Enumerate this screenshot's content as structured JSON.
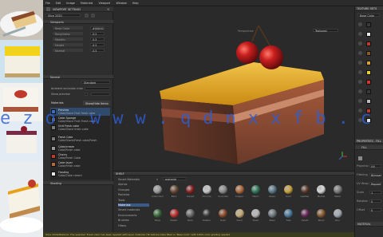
{
  "menu": [
    "File",
    "Edit",
    "Image",
    "Materials",
    "Viewport",
    "Window",
    "Help"
  ],
  "left_panel": {
    "title": "VIEWPORT SETTINGS",
    "preset": "Slice 2020",
    "section1": "Viewports",
    "fields": [
      {
        "label": "Base Color",
        "value": "#00000"
      },
      {
        "label": "Roughness",
        "value": "0.5"
      },
      {
        "label": "Metallic",
        "value": "0.5"
      },
      {
        "label": "Height",
        "value": "0.5"
      },
      {
        "label": "Normal",
        "value": "0.5"
      }
    ],
    "section2": "Normal",
    "normal_mode": "Standard",
    "ambient_label": "Ambient occlusion mixing",
    "show_label": "Show preview",
    "materials_label": "Materials",
    "materials_btn": "Show/Hide Items",
    "section3": "Shading",
    "layers": [
      {
        "name": "Preview",
        "desc": "Cake/Glace Fruit fresh cake",
        "color": "#3a6fc7"
      },
      {
        "name": "Cake Sponge",
        "desc": "Cake/Glace Fruit Fresh cake",
        "color": "#6a6a6a"
      },
      {
        "name": "Unit Fresh cake",
        "desc": "Cake/Glace fresh cake",
        "color": "#7a7a7a"
      },
      {
        "name": "Fresh Cake",
        "desc": "Cake/Glace/Fresh cake/Fresh",
        "color": "#7a7a7a"
      },
      {
        "name": "Cake/cream",
        "desc": "Cake/Fresh cake",
        "color": "#9a9a9a"
      },
      {
        "name": "Cherry",
        "desc": "Cake/Fresh Cake",
        "color": "#c0392b"
      },
      {
        "name": "Cake layer",
        "desc": "Cake/Fresh cake",
        "color": "#b46a3a"
      },
      {
        "name": "Frosting",
        "desc": "Cake/Cake cream",
        "color": "#e8e8e8"
      }
    ]
  },
  "viewport": {
    "mode": "Textured",
    "toolbar_label": "Perspective"
  },
  "right_panel": {
    "title": "TEXTURE SETS",
    "dropdown": "Base Color",
    "swatches": [
      "#3b3b3b",
      "#e8e8e8",
      "#c0392b",
      "#8b5a2b",
      "#d8a030",
      "#e6d22a",
      "#d9342b",
      "#3a3a3a",
      "#bbbbbb",
      "#c23a2a",
      "#e0e0e0"
    ],
    "section2": "PROPERTIES - FILL",
    "section3": "FILL",
    "props": [
      {
        "label": "Projection",
        "value": "UV"
      },
      {
        "label": "Filtering",
        "value": "Bilinear"
      },
      {
        "label": "UV Wrap",
        "value": "Repeat"
      },
      {
        "label": "Scale",
        "value": "1"
      },
      {
        "label": "Rotation",
        "value": "0"
      },
      {
        "label": "Offset",
        "value": "0"
      }
    ],
    "section4": "MATERIAL"
  },
  "shelf": {
    "title": "SHELF",
    "search": "material",
    "categories": [
      "Smart Materials",
      "Alphas",
      "Grunges",
      "Particles",
      "Tools",
      "Materials",
      "Smart materials",
      "Environments",
      "Brushes",
      "Filters"
    ],
    "materials": [
      {
        "name": "Aluminium",
        "color": "#9a9a9a"
      },
      {
        "name": "Bark",
        "color": "#6b4a34"
      },
      {
        "name": "Carpet",
        "color": "#8b2020"
      },
      {
        "name": "Chrome",
        "color": "#c8c8c8"
      },
      {
        "name": "Concrete",
        "color": "#8c8c8c"
      },
      {
        "name": "Copper",
        "color": "#b06a3a"
      },
      {
        "name": "Fabric",
        "color": "#2f7a5a"
      },
      {
        "name": "Glass",
        "color": "#5a7a8a"
      },
      {
        "name": "Gold",
        "color": "#c9a23a"
      },
      {
        "name": "Leather",
        "color": "#5a3a2a"
      },
      {
        "name": "Marble",
        "color": "#d8d8d8"
      },
      {
        "name": "Metal",
        "color": "#7a7a7a"
      },
      {
        "name": "Moss",
        "color": "#3a6a3a"
      },
      {
        "name": "Plastic",
        "color": "#c23030"
      },
      {
        "name": "Rock",
        "color": "#6a6a6a"
      },
      {
        "name": "Rubber",
        "color": "#3a3a3a"
      },
      {
        "name": "Rust",
        "color": "#8a4a2a"
      },
      {
        "name": "Sand",
        "color": "#c8aa78"
      },
      {
        "name": "Silver",
        "color": "#b8b8b8"
      },
      {
        "name": "Steel",
        "color": "#707880"
      },
      {
        "name": "Tiles",
        "color": "#4a7aa0"
      },
      {
        "name": "Velvet",
        "color": "#6a2a5a"
      },
      {
        "name": "Wood",
        "color": "#8a5a30"
      },
      {
        "name": "Zinc",
        "color": "#a0a8b0"
      }
    ]
  },
  "status": "Slice 2020/Material: The selected 'Fresh cake' has been applied with layer material. Hit texture Cake filled in 'Base Color' with 100% color grading applied",
  "watermark": "ezo www.qdnxxfb.com",
  "colors": {
    "accent": "#3a6fc7",
    "panel": "#2e2e2e",
    "viewport": "#2a2a2a",
    "status": "#d8c25a"
  }
}
